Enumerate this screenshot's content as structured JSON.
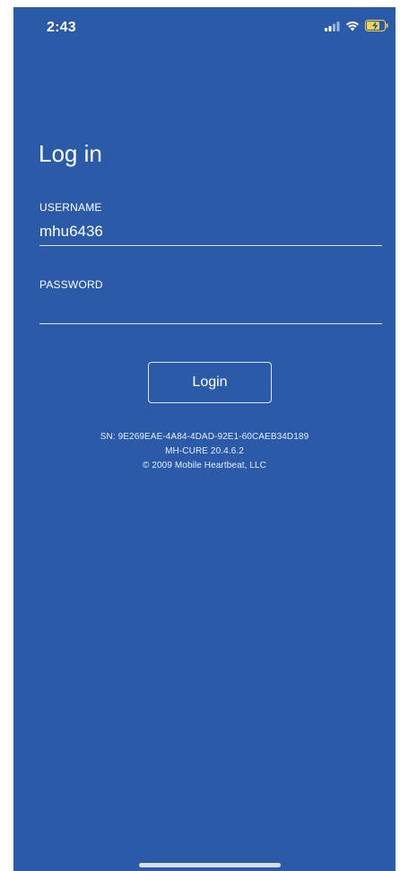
{
  "status_bar": {
    "time": "2:43",
    "icons": [
      "signal-icon",
      "wifi-icon",
      "battery-charging-icon"
    ]
  },
  "login_screen": {
    "title": "Log in",
    "username": {
      "label": "USERNAME",
      "value": "mhu6436"
    },
    "password": {
      "label": "PASSWORD",
      "value": ""
    },
    "login_button_label": "Login"
  },
  "footer": {
    "serial": "SN: 9E269EAE-4A84-4DAD-92E1-60CAEB34D189",
    "version": "MH-CURE 20.4.6.2",
    "copyright": "© 2009 Mobile Heartbeat, LLC"
  },
  "colors": {
    "background": "#2b5ba8",
    "text": "#ffffff",
    "battery_charging": "#f4d24b"
  }
}
